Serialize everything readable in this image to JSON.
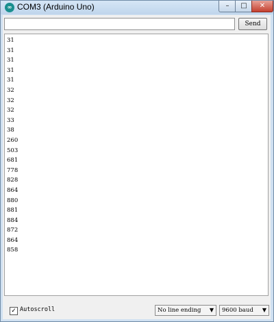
{
  "window": {
    "title": "COM3 (Arduino Uno)",
    "icon": "arduino-icon",
    "controls": {
      "minimize": "–",
      "maximize": "□",
      "close": "✕"
    }
  },
  "send": {
    "input_value": "",
    "button_label": "Send"
  },
  "output": {
    "lines": [
      "31",
      "31",
      "31",
      "31",
      "31",
      "32",
      "32",
      "32",
      "33",
      "38",
      "260",
      "503",
      "681",
      "778",
      "828",
      "864",
      "880",
      "881",
      "884",
      "872",
      "864",
      "858"
    ]
  },
  "footer": {
    "autoscroll_label": "Autoscroll",
    "autoscroll_checked": true,
    "line_ending": "No line ending",
    "baud": "9600 baud"
  }
}
